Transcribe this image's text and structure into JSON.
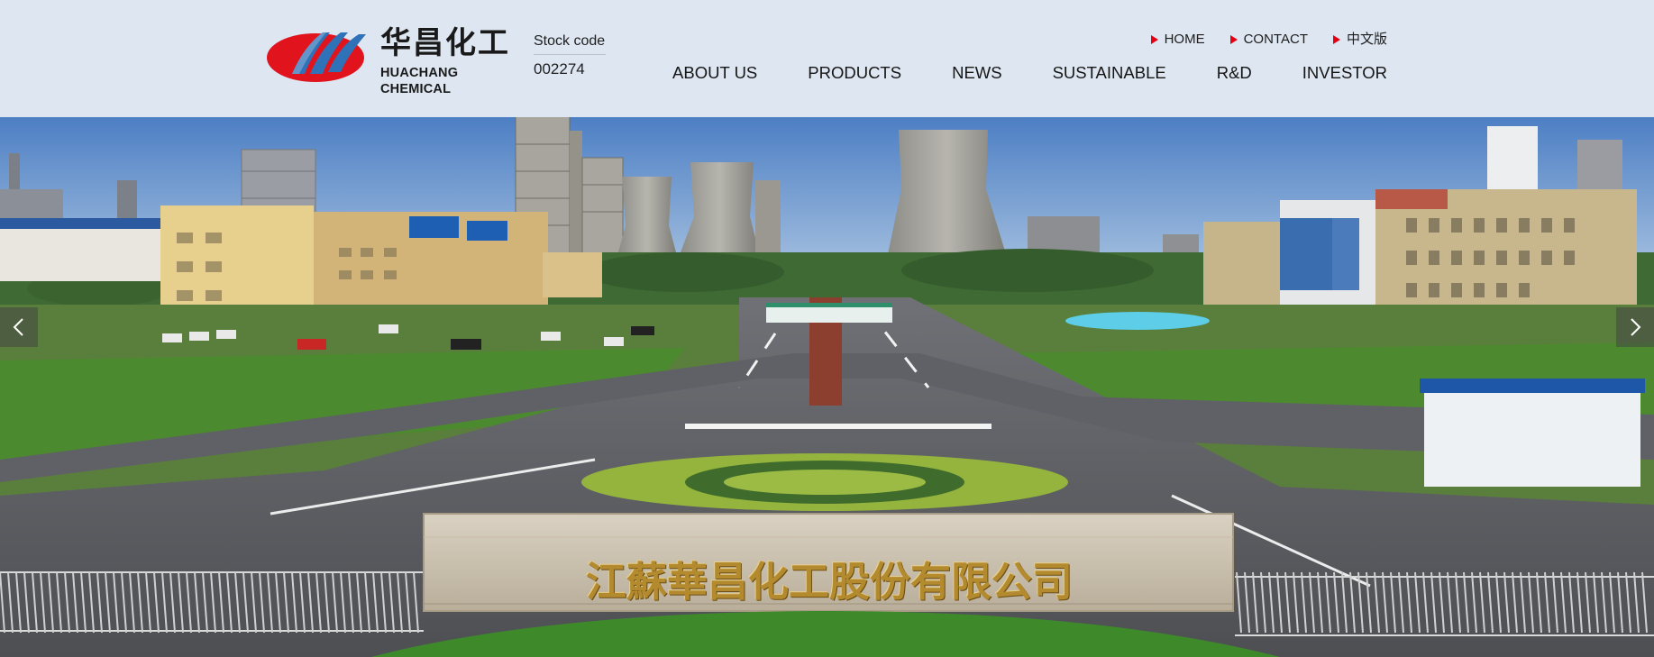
{
  "header": {
    "logo": {
      "cn_text": "华昌化工",
      "en_text": "HUACHANG CHEMICAL",
      "icon": "huachang-logo-mark"
    },
    "stock": {
      "label": "Stock code",
      "code": "002274"
    },
    "top_links": [
      {
        "label": "HOME",
        "icon": "red-triangle-icon"
      },
      {
        "label": "CONTACT",
        "icon": "red-triangle-icon"
      },
      {
        "label": "中文版",
        "icon": "red-triangle-icon"
      }
    ],
    "nav": [
      "ABOUT US",
      "PRODUCTS",
      "NEWS",
      "SUSTAINABLE",
      "R&D",
      "INVESTOR"
    ]
  },
  "banner": {
    "stone_inscription": "江蘇華昌化工股份有限公司",
    "prev_icon": "chevron-left-icon",
    "next_icon": "chevron-right-icon"
  },
  "colors": {
    "header_bg": "#dde6f1",
    "accent_red": "#e60012",
    "logo_red": "#e1141d",
    "logo_blue": "#2f72b8",
    "inscription_gold": "#b48a2f"
  }
}
